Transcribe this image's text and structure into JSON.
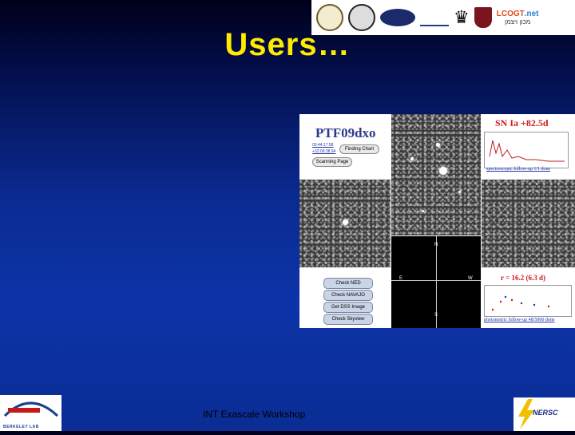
{
  "slide": {
    "title": "Users…",
    "footer": "INT Exascale Workshop"
  },
  "logos": {
    "lcogt_main": "LCOGT",
    "lcogt_suffix": ".net",
    "oval_logo": "",
    "nersc": "NERSC",
    "berkeley_lab": "BERKELEY LAB"
  },
  "ptf_panel": {
    "name": "PTF09dxo",
    "ra": "03:44:17.58",
    "dec": "+32:09:38.94",
    "finding_chart_button": "Finding Chart",
    "scanning_page_button": "Scanning Page",
    "classification": "SN Ia +82.5d",
    "spectroscopy_caption": "spectroscopic follow-up 1/1 done",
    "magnitude": "r = 16.2 (6.3 d)",
    "photometry_caption": "photometric follow-up 48/5000 done",
    "finder": {
      "north": "N",
      "east": "E",
      "west": "W",
      "south": "S"
    },
    "check_buttons": [
      "Check NED",
      "Check NAVAJO",
      "Get DSS Image",
      "Check Skyview"
    ]
  },
  "colors": {
    "title": "#ffea00",
    "classification": "#d31a1a",
    "ptf_name": "#2b3a8a"
  }
}
